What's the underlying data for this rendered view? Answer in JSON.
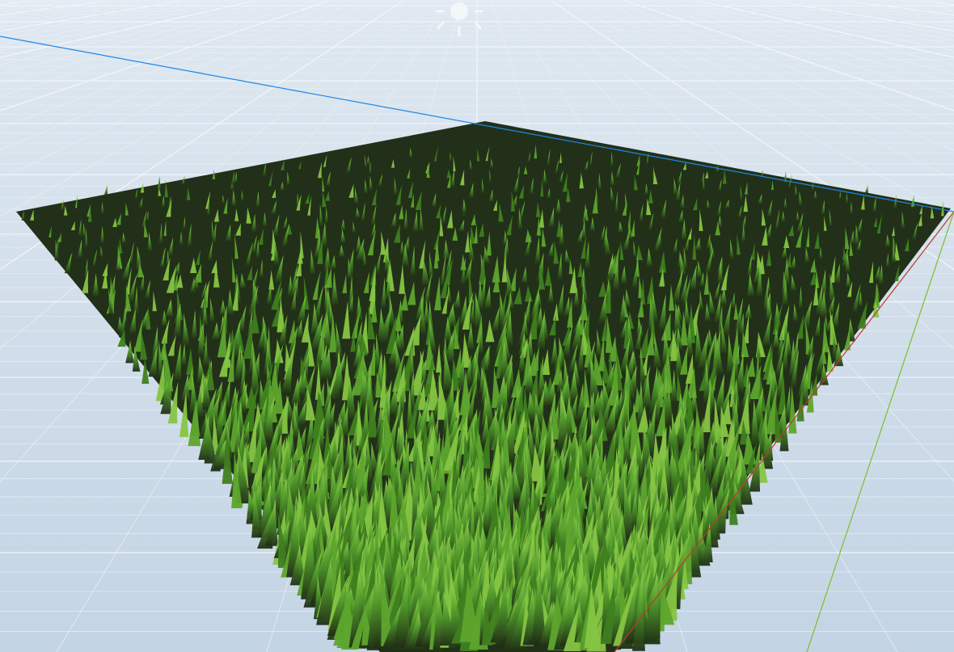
{
  "scene": {
    "background_top": "#dbe5ee",
    "background_bottom": "#c5d6e5",
    "grid_line_color": "#e6eef5",
    "grid_major_color": "#f2f6fa",
    "axis_x_color": "#c0392b",
    "axis_y_color": "#7cbf2a",
    "axis_z_color": "#1e88e5",
    "grass_shadow": "#223019",
    "grass_dark": "#3f7f1f",
    "grass_mid": "#5ea52e",
    "grass_light": "#86c543",
    "sun_icon": "sun-light-icon",
    "sun_color": "#f4f7fa"
  }
}
